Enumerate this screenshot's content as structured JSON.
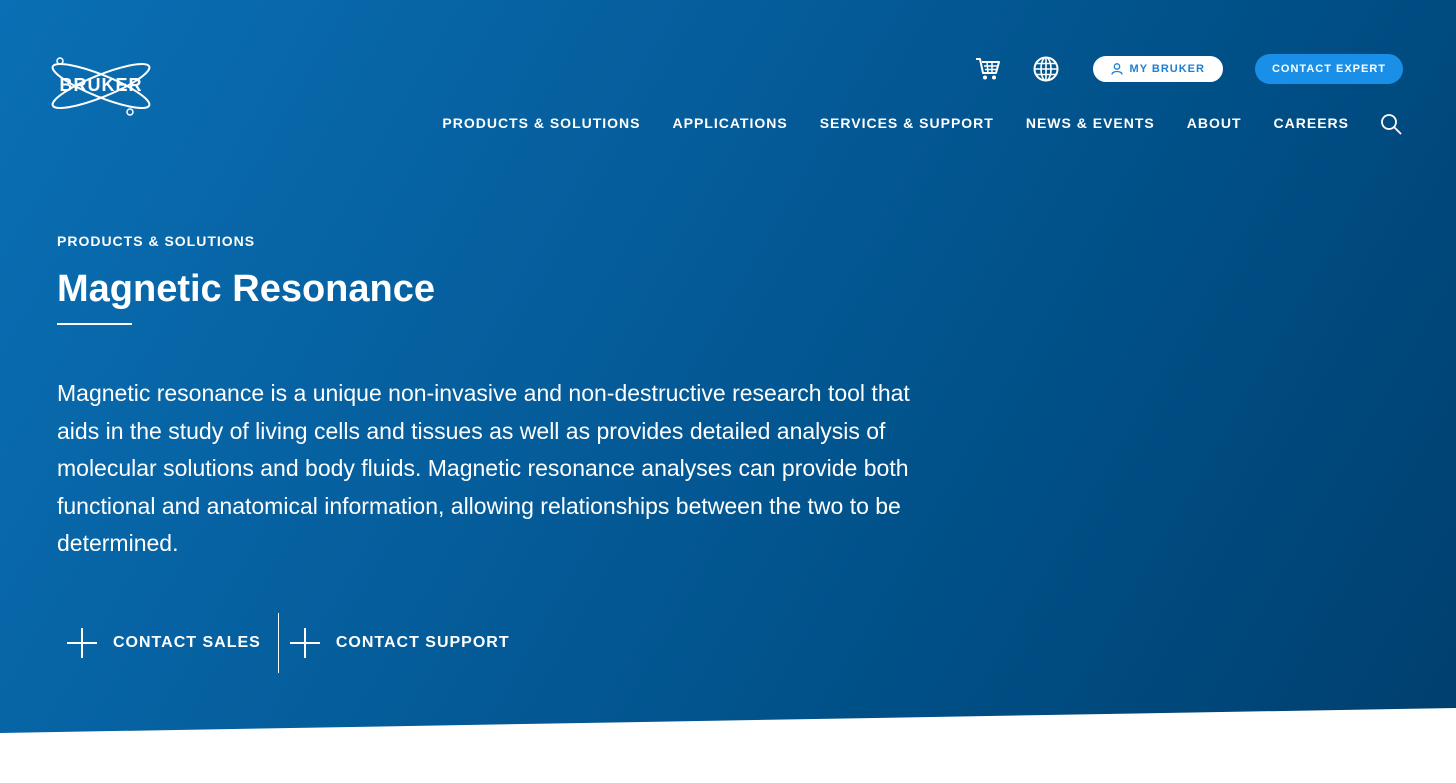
{
  "brand": {
    "logo_text": "BRUKER"
  },
  "header": {
    "utility": {
      "cart_icon": "cart-icon",
      "globe_icon": "globe-icon",
      "my_bruker_label": "MY BRUKER",
      "contact_expert_label": "CONTACT EXPERT"
    },
    "nav": [
      {
        "label": "PRODUCTS & SOLUTIONS"
      },
      {
        "label": "APPLICATIONS"
      },
      {
        "label": "SERVICES & SUPPORT"
      },
      {
        "label": "NEWS & EVENTS"
      },
      {
        "label": "ABOUT"
      },
      {
        "label": "CAREERS"
      }
    ],
    "search_icon": "search-icon"
  },
  "hero": {
    "eyebrow": "PRODUCTS & SOLUTIONS",
    "title": "Magnetic Resonance",
    "description": "Magnetic resonance is a unique non-invasive and non-destructive research tool that aids in the study of living cells and tissues as well as provides detailed analysis of molecular solutions and body fluids. Magnetic resonance analyses can provide both functional and anatomical information, allowing relationships between the two to be determined.",
    "actions": {
      "contact_sales": "CONTACT SALES",
      "contact_support": "CONTACT SUPPORT"
    }
  },
  "colors": {
    "hero_start": "#0a6fb4",
    "hero_end": "#003f6e",
    "accent_button": "#1a8fe8",
    "my_bruker_text": "#1a7fd6"
  }
}
